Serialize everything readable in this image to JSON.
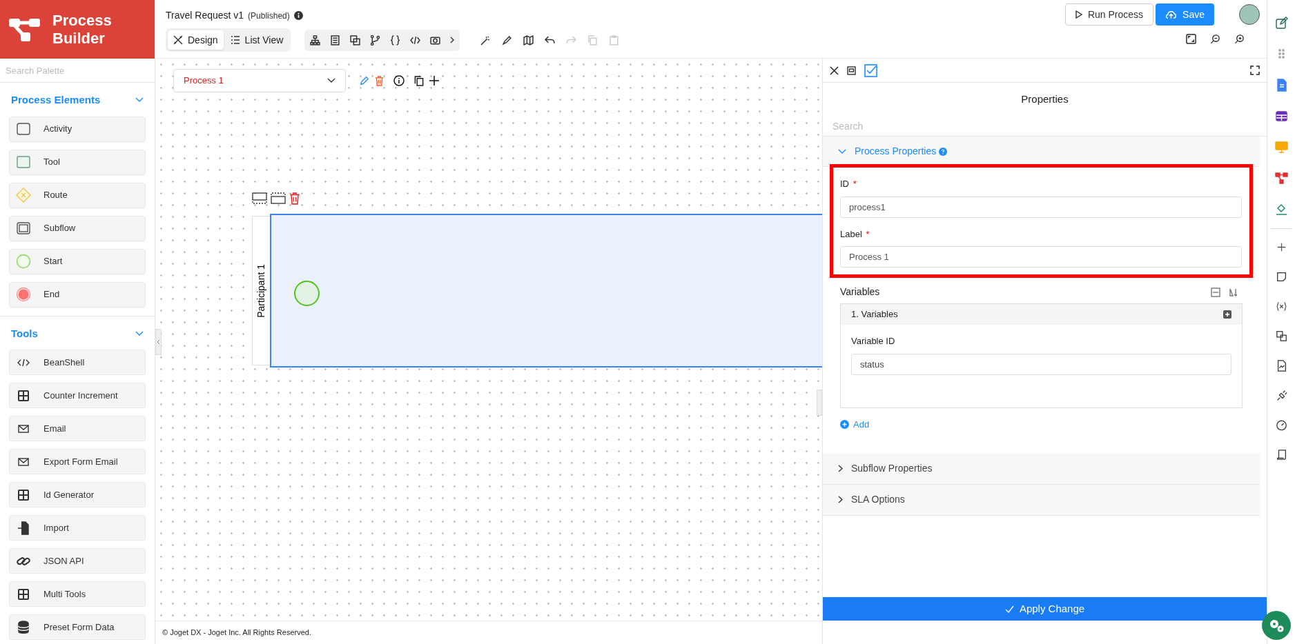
{
  "logo": {
    "text": "Process Builder"
  },
  "header": {
    "title": "Travel Request v1",
    "status": "(Published)",
    "run_button": "Run Process",
    "save_button": "Save",
    "view_tabs": [
      {
        "label": "Design",
        "selected": true
      },
      {
        "label": "List View",
        "selected": false
      }
    ]
  },
  "palette": {
    "search_placeholder": "Search Palette",
    "groups": [
      {
        "title": "Process Elements",
        "expanded": true,
        "items": [
          {
            "label": "Activity",
            "kind": "activity"
          },
          {
            "label": "Tool",
            "kind": "tool"
          },
          {
            "label": "Route",
            "kind": "route"
          },
          {
            "label": "Subflow",
            "kind": "subflow"
          },
          {
            "label": "Start",
            "kind": "start"
          },
          {
            "label": "End",
            "kind": "end"
          }
        ]
      },
      {
        "title": "Tools",
        "expanded": true,
        "items": [
          {
            "label": "BeanShell",
            "kind": "code"
          },
          {
            "label": "Counter Increment",
            "kind": "grid"
          },
          {
            "label": "Email",
            "kind": "mail"
          },
          {
            "label": "Export Form Email",
            "kind": "mail"
          },
          {
            "label": "Id Generator",
            "kind": "grid"
          },
          {
            "label": "Import",
            "kind": "import"
          },
          {
            "label": "JSON API",
            "kind": "link"
          },
          {
            "label": "Multi Tools",
            "kind": "grid"
          },
          {
            "label": "Preset Form Data",
            "kind": "database"
          }
        ]
      }
    ]
  },
  "canvas": {
    "process_select": "Process 1",
    "participant": "Participant 1",
    "footer": "© Joget DX - Joget Inc. All Rights Reserved."
  },
  "properties": {
    "title": "Properties",
    "search_placeholder": "Search",
    "sections": [
      {
        "title": "Process Properties",
        "expanded": true,
        "fields": [
          {
            "label": "ID",
            "required_mark": "*",
            "value": "process1"
          },
          {
            "label": "Label",
            "required_mark": "*",
            "value": "Process 1"
          }
        ],
        "variables": {
          "label": "Variables",
          "items": [
            {
              "title": "1. Variables",
              "field_label": "Variable ID",
              "value": "status"
            }
          ],
          "add": "Add"
        }
      },
      {
        "title": "Subflow Properties",
        "expanded": false
      },
      {
        "title": "SLA Options",
        "expanded": false
      }
    ],
    "apply_button": "Apply Change"
  }
}
